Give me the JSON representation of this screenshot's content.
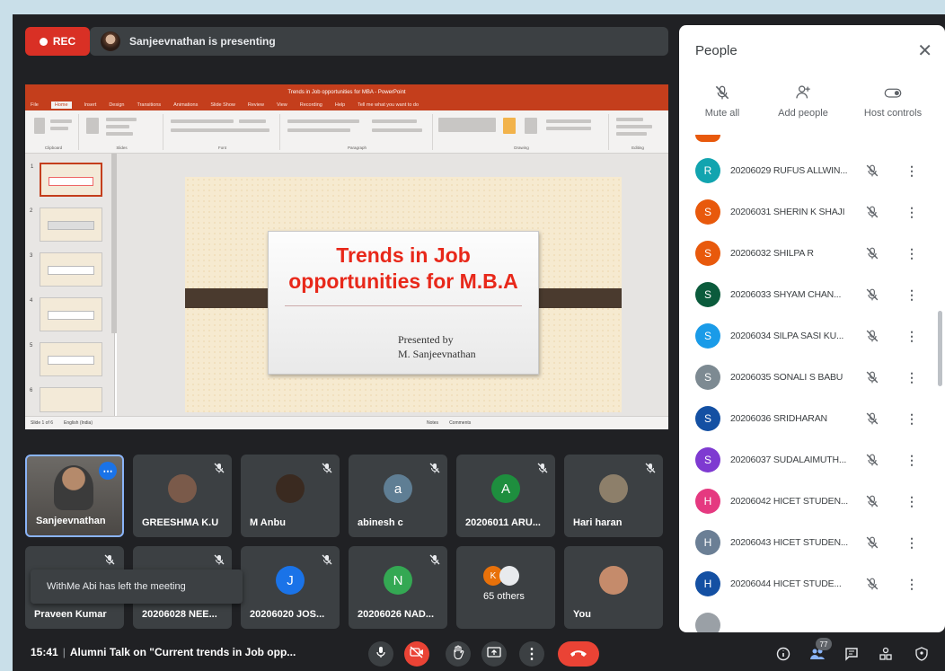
{
  "top_bar": {
    "rec_label": "REC",
    "presenting_text": "Sanjeevnathan is presenting"
  },
  "powerpoint": {
    "title": "Trends in Job opportunities for MBA - PowerPoint",
    "tabs": [
      "File",
      "Home",
      "Insert",
      "Design",
      "Transitions",
      "Animations",
      "Slide Show",
      "Review",
      "View",
      "Recording",
      "Help",
      "Tell me what you want to do"
    ],
    "ribbon_groups": [
      "Clipboard",
      "Slides",
      "Font",
      "Paragraph",
      "Drawing",
      "Editing"
    ],
    "slide_title": "Trends in Job opportunities for M.B.A",
    "slide_subtitle_line1": "Presented by",
    "slide_subtitle_line2": "M. Sanjeevnathan",
    "status_left": "Slide 1 of 6",
    "status_lang": "English (India)",
    "status_notes": "Notes",
    "status_comments": "Comments",
    "thumb_numbers": [
      "1",
      "2",
      "3",
      "4",
      "5",
      "6"
    ]
  },
  "tiles": [
    {
      "name": "Sanjeevnathan",
      "self": true
    },
    {
      "name": "GREESHMA K.U",
      "avatar_color": "#7a5a4a"
    },
    {
      "name": "M Anbu",
      "avatar_color": "#3a2a20"
    },
    {
      "name": "abinesh c",
      "initial": "a",
      "avatar_color": "#5f7e94"
    },
    {
      "name": "20206011 ARU...",
      "initial": "A",
      "avatar_color": "#1e8e3e"
    },
    {
      "name": "Hari haran",
      "avatar_color": "#8d7f6a"
    },
    {
      "name": "Praveen Kumar"
    },
    {
      "name": "20206028 NEE..."
    },
    {
      "name": "20206020 JOS...",
      "initial": "J",
      "avatar_color": "#1a73e8"
    },
    {
      "name": "20206026 NAD...",
      "initial": "N",
      "avatar_color": "#34a853"
    },
    {
      "name": "65 others",
      "initial": "K",
      "avatar_color": "#e8710a"
    },
    {
      "name": "You",
      "avatar_color": "#c58b6b"
    }
  ],
  "toast": "WithMe Abi has left the meeting",
  "bottom_bar": {
    "time": "15:41",
    "meeting_title": "Alumni Talk on \"Current trends in Job opp...",
    "people_count": "77"
  },
  "people_panel": {
    "title": "People",
    "actions": [
      "Mute all",
      "Add people",
      "Host controls"
    ],
    "participants": [
      {
        "initial": "R",
        "name": "20206029 RUFUS ALLWIN...",
        "color": "#12a4af"
      },
      {
        "initial": "S",
        "name": "20206031 SHERIN K SHAJI",
        "color": "#e8590c"
      },
      {
        "initial": "S",
        "name": "20206032 SHILPA R",
        "color": "#e8590c"
      },
      {
        "initial": "S",
        "name": "20206033 SHYAM CHAN...",
        "color": "#0b5b3c"
      },
      {
        "initial": "S",
        "name": "20206034 SILPA SASI KU...",
        "color": "#1a9be8"
      },
      {
        "initial": "S",
        "name": "20206035 SONALI S BABU",
        "color": "#7d8a92"
      },
      {
        "initial": "S",
        "name": "20206036 SRIDHARAN",
        "color": "#1450a3"
      },
      {
        "initial": "S",
        "name": "20206037 SUDALAIMUTH...",
        "color": "#7e3ad1"
      },
      {
        "initial": "H",
        "name": "20206042 HICET STUDEN...",
        "color": "#e53980"
      },
      {
        "initial": "H",
        "name": "20206043 HICET STUDEN...",
        "color": "#6b7f95"
      },
      {
        "initial": "H",
        "name": "20206044 HICET STUDE...",
        "color": "#1450a3"
      }
    ]
  }
}
